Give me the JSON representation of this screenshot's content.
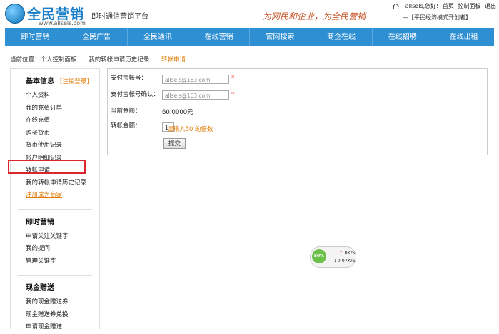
{
  "header": {
    "logo_cn": "全民营销",
    "logo_url": "www.allsels.com",
    "logo_sub": "即时通信营销平台",
    "slogan": "为网民和企业，为全民营销",
    "slogan_tag": "—【平民经济模式开创者】",
    "user_greeting": "allsels,您好!",
    "links": [
      "首页",
      "控制面板",
      "退出"
    ]
  },
  "nav": {
    "items": [
      "即时营销",
      "全民广告",
      "全民通讯",
      "在线营销",
      "官网搜索",
      "商企在线",
      "在线招聘",
      "在线出租"
    ]
  },
  "breadcrumb": {
    "prefix": "当前位置：个人控制面板",
    "item1": "我的转帐申请历史记录",
    "current": "转帐申请"
  },
  "sidebar": {
    "basic_title": "基本信息",
    "logout_label": "[注销登录]",
    "basic_items": [
      "个人资料",
      "我的充值订单",
      "在线充值",
      "购买货币",
      "货币使用记录",
      "帐户明细记录",
      "转帐申请",
      "我的转帐申请历史记录"
    ],
    "merchant_link": "注册成为商家",
    "instant_title": "即时营销",
    "instant_items": [
      "申请关注关键字",
      "我的提问",
      "管理关键字"
    ],
    "cash_title": "现金赠送",
    "cash_items": [
      "我的现金赠送券",
      "现金赠送券兑换",
      "申请现金赠送"
    ]
  },
  "form": {
    "alipay_label": "支付宝帐号：",
    "alipay_value": "allsels@163.com",
    "alipay_confirm_label": "支付宝帐号确认：",
    "alipay_confirm_value": "allsels@163.com",
    "balance_label": "当前金额：",
    "balance_value": "60.0000元",
    "amount_label": "转帐金额：",
    "amount_value": "1",
    "hint": "请输入50 的倍数",
    "required_mark": "*",
    "submit_label": "提交"
  },
  "speed_widget": {
    "percent": "50%",
    "up": "0K/S",
    "down": "0.07K/S"
  }
}
